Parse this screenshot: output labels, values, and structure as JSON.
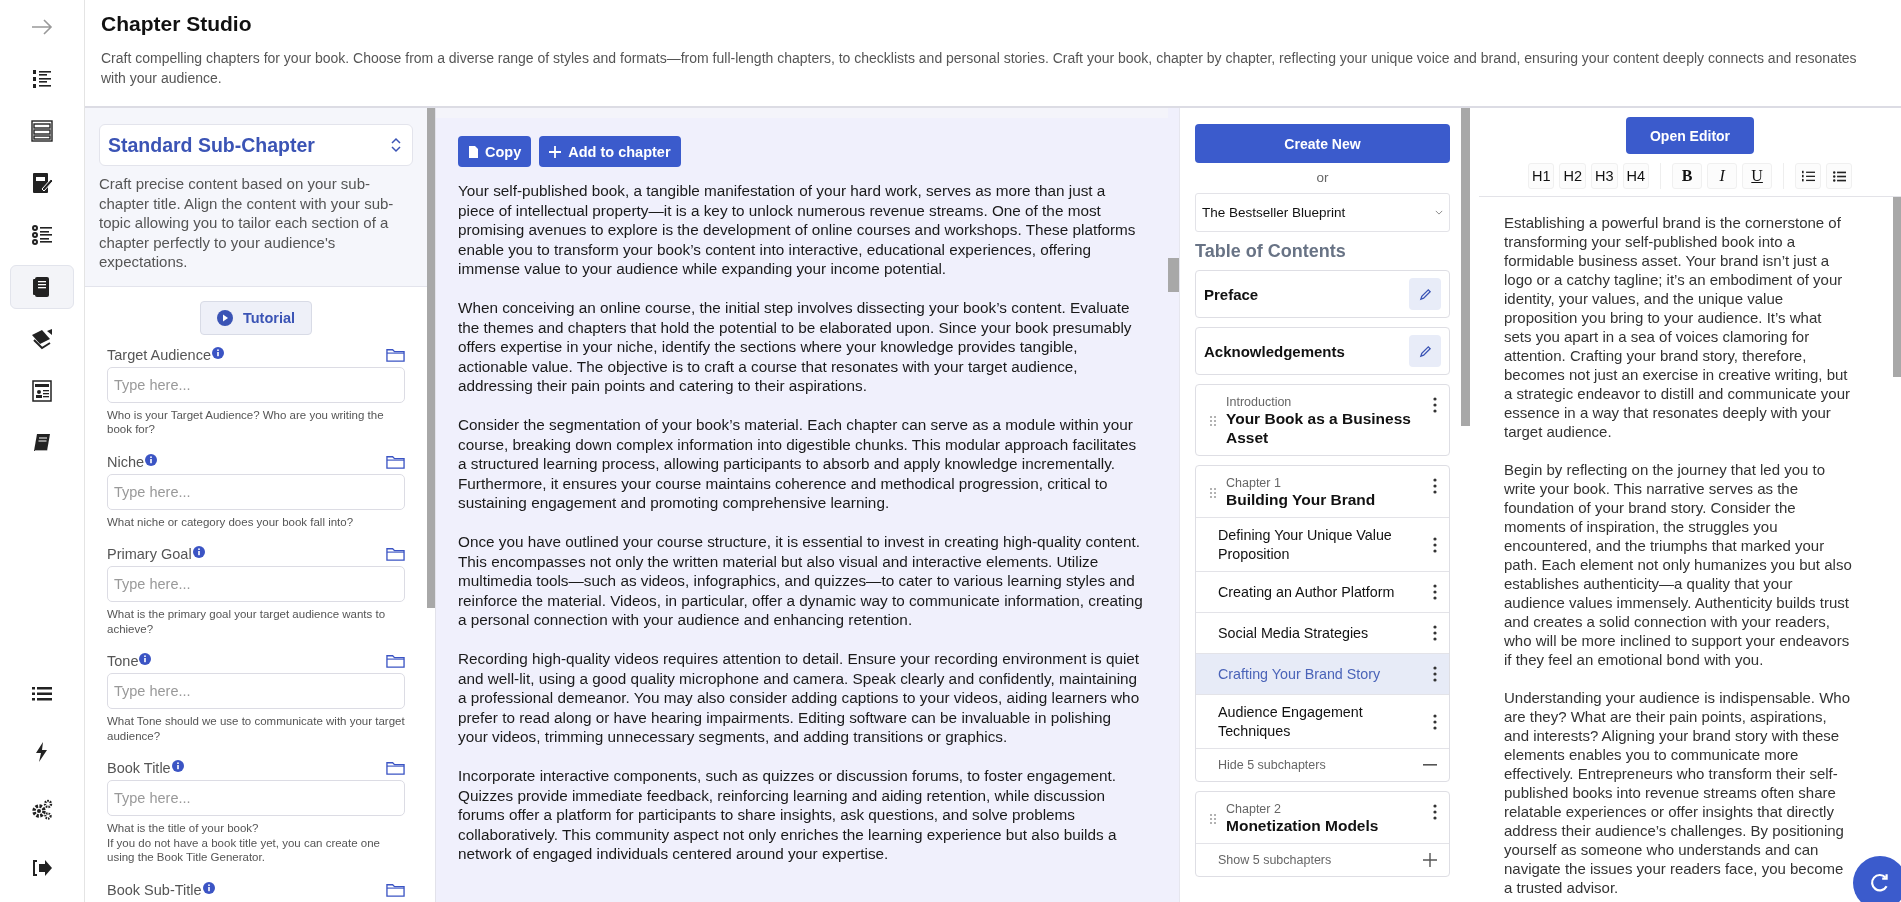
{
  "sidebar": {
    "items": [
      {
        "selected": false
      },
      {
        "selected": false
      },
      {
        "selected": false
      },
      {
        "selected": false
      },
      {
        "selected": false
      },
      {
        "selected": true
      },
      {
        "selected": false
      },
      {
        "selected": false
      },
      {
        "selected": false
      },
      {
        "selected": false
      },
      {
        "selected": false
      },
      {
        "selected": false
      },
      {
        "selected": false
      }
    ]
  },
  "header": {
    "title": "Chapter Studio",
    "description": "Craft compelling chapters for your book. Choose from a diverse range of styles and formats—from full-length chapters, to checklists and personal stories. Craft your book, chapter by chapter, reflecting your unique voice and brand, ensuring your content deeply connects and resonates with your audience."
  },
  "form_panel": {
    "template": "Standard Sub-Chapter",
    "description": "Craft precise content based on your sub-chapter title. Align the content with your sub-topic allowing you to tailor each section of a chapter perfectly to your audience's expectations.",
    "tutorial_button": "Tutorial",
    "fields": [
      {
        "label": "Target Audience",
        "placeholder": "Type here...",
        "help": "Who is your Target Audience? Who are you writing the book for?"
      },
      {
        "label": "Niche",
        "placeholder": "Type here...",
        "help": "What niche or category does your book fall into?"
      },
      {
        "label": "Primary Goal",
        "placeholder": "Type here...",
        "help": "What is the primary goal your target audience wants to achieve?"
      },
      {
        "label": "Tone",
        "placeholder": "Type here...",
        "help": "What Tone should we use to communicate with your target audience?"
      },
      {
        "label": "Book Title",
        "placeholder": "Type here...",
        "help": "What is the title of your book?\nIf you do not have a book title yet, you can create one using the Book Title Generator."
      },
      {
        "label": "Book Sub-Title"
      }
    ]
  },
  "content": {
    "buttons": [
      "Copy",
      "Add to chapter"
    ],
    "paragraphs": [
      "Your self-published book, a tangible manifestation of your hard work, serves as more than just a piece of intellectual property—it is a key to unlock numerous revenue streams. One of the most promising avenues to explore is the development of online courses and workshops. These platforms enable you to transform your book’s content into interactive, educational experiences, offering immense value to your audience while expanding your income potential.",
      "When conceiving an online course, the initial step involves dissecting your book’s content. Evaluate the themes and chapters that hold the potential to be elaborated upon. Since your book presumably offers expertise in your niche, identify the sections where your knowledge provides tangible, actionable value. The objective is to craft a course that resonates with your target audience, addressing their pain points and catering to their aspirations.",
      "Consider the segmentation of your book’s material. Each chapter can serve as a module within your course, breaking down complex information into digestible chunks. This modular approach facilitates a structured learning process, allowing participants to absorb and apply knowledge incrementally. Furthermore, it ensures your course maintains coherence and methodical progression, critical to sustaining engagement and promoting comprehensive learning.",
      "Once you have outlined your course structure, it is essential to invest in creating high-quality content. This encompasses not only the written material but also visual and interactive elements. Utilize multimedia tools—such as videos, infographics, and quizzes—to cater to various learning styles and reinforce the material. Videos, in particular, offer a dynamic way to communicate information, creating a personal connection with your audience and enhancing retention.",
      "Recording high-quality videos requires attention to detail. Ensure your recording environment is quiet and well-lit, using a good quality microphone and camera. Speak clearly and confidently, maintaining a professional demeanor. You may also consider adding captions to your videos, aiding learners who prefer to read along or have hearing impairments. Editing software can be invaluable in polishing your videos, trimming unnecessary segments, and adding transitions or graphics.",
      "Incorporate interactive components, such as quizzes or discussion forums, to foster engagement. Quizzes provide immediate feedback, reinforcing learning and aiding retention, while discussion forums offer a platform for participants to share insights, ask questions, and solve problems collaboratively. This community aspect not only enriches the learning experience but also builds a network of engaged individuals centered around your expertise."
    ]
  },
  "toc": {
    "create_button": "Create New",
    "or_text": "or",
    "book_select": "The Bestseller Blueprint",
    "heading": "Table of Contents",
    "sections": [
      {
        "kind": "simple",
        "title": "Preface"
      },
      {
        "kind": "simple",
        "title": "Acknowledgements"
      },
      {
        "kind": "chapter",
        "label": "Introduction",
        "title": "Your Book as a Business Asset"
      },
      {
        "kind": "chapter",
        "label": "Chapter 1",
        "title": "Building Your Brand",
        "expanded": true,
        "subchapters": [
          {
            "title": "Defining Your Unique Value Proposition",
            "selected": false
          },
          {
            "title": "Creating an Author Platform",
            "selected": false
          },
          {
            "title": "Social Media Strategies",
            "selected": false
          },
          {
            "title": "Crafting Your Brand Story",
            "selected": true
          },
          {
            "title": "Audience Engagement Techniques",
            "selected": false
          }
        ],
        "toggle": "Hide 5 subchapters"
      },
      {
        "kind": "chapter",
        "label": "Chapter 2",
        "title": "Monetization Models",
        "expanded": false,
        "toggle": "Show 5 subchapters"
      }
    ]
  },
  "editor": {
    "open_button": "Open Editor",
    "toolbar": [
      {
        "kind": "heading",
        "label": "H1"
      },
      {
        "kind": "heading",
        "label": "H2"
      },
      {
        "kind": "heading",
        "label": "H3"
      },
      {
        "kind": "heading",
        "label": "H4"
      },
      {
        "kind": "bold",
        "label": "B"
      },
      {
        "kind": "italic",
        "label": "I"
      },
      {
        "kind": "underline",
        "label": "U"
      }
    ],
    "paragraphs": [
      "Establishing a powerful brand is the cornerstone of transforming your self-published book into a formidable business asset. Your brand isn’t just a logo or a catchy tagline; it’s an embodiment of your identity, your values, and the unique value proposition you bring to your audience. It’s what sets you apart in a sea of voices clamoring for attention. Crafting your brand story, therefore, becomes not just an exercise in creative writing, but a strategic endeavor to distill and communicate your essence in a way that resonates deeply with your target audience.",
      "Begin by reflecting on the journey that led you to write your book. This narrative serves as the foundation of your brand story. Consider the moments of inspiration, the struggles you encountered, and the triumphs that marked your path. Each element not only humanizes you but also establishes authenticity—a quality that your audience values immensely. Authenticity builds trust and creates a solid connection with your readers, who will be more inclined to support your endeavors if they feel an emotional bond with you.",
      "Understanding your audience is indispensable. Who are they? What are their pain points, aspirations, and interests? Aligning your brand story with these elements enables you to communicate more effectively. Entrepreneurs who transform their self-published books into revenue streams often share relatable experiences or offer insights that directly address their audience’s challenges. By positioning yourself as someone who understands and can navigate the issues your readers face, you become a trusted advisor."
    ]
  }
}
